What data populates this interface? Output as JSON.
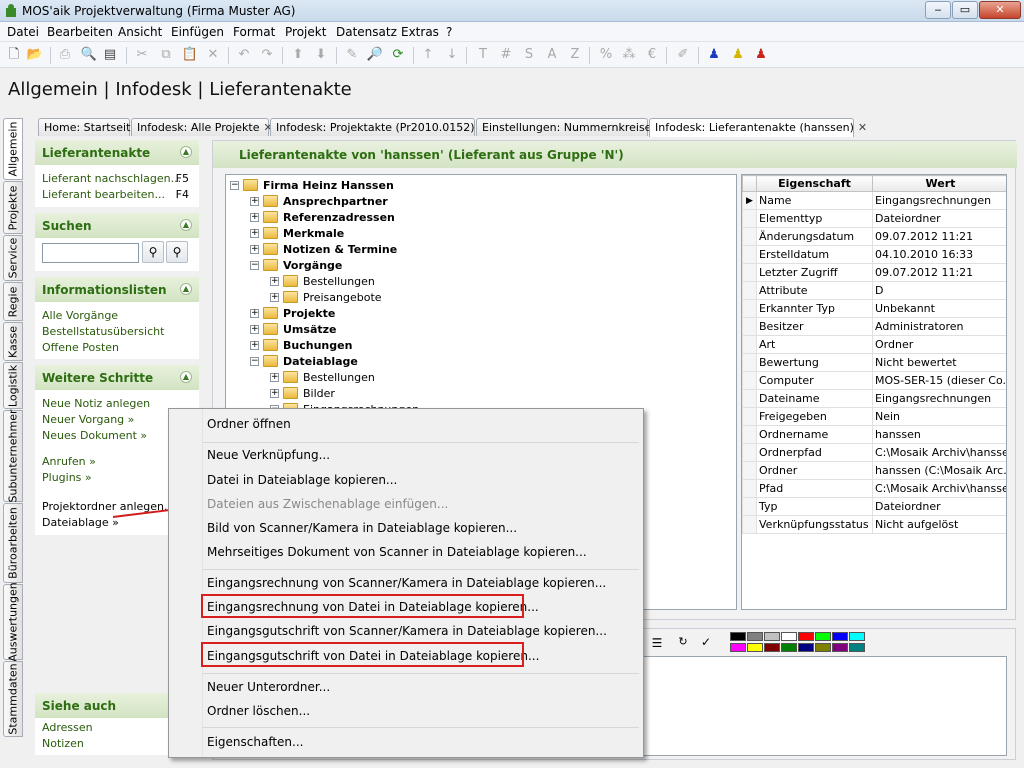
{
  "window": {
    "title": "MOS'aik Projektverwaltung (Firma Muster AG)",
    "minimize": "‒",
    "maximize": "▭",
    "close": "✕"
  },
  "menu": [
    "Datei",
    "Bearbeiten",
    "Ansicht",
    "Einfügen",
    "Format",
    "Projekt",
    "Datensatz",
    "Extras",
    "?"
  ],
  "breadcrumb": "Allgemein | Infodesk | Lieferantenakte",
  "tabs": [
    {
      "label": "Home: Startseite",
      "closable": false
    },
    {
      "label": "Infodesk: Alle Projekte",
      "closable": true
    },
    {
      "label": "Infodesk: Projektakte (Pr2010.0152)",
      "closable": true
    },
    {
      "label": "Einstellungen: Nummernkreise",
      "closable": true
    },
    {
      "label": "Infodesk: Lieferantenakte (hanssen)",
      "closable": true,
      "active": true
    }
  ],
  "vertical_tabs": [
    "Allgemein",
    "Projekte",
    "Service",
    "Regie",
    "Kasse",
    "Logistik",
    "Subunternehmer",
    "Büroarbeiten",
    "Auswertungen",
    "Stammdaten"
  ],
  "sidebar": {
    "lieferantenakte": {
      "title": "Lieferantenakte",
      "items": [
        {
          "label": "Lieferant nachschlagen...",
          "shortcut": "F5"
        },
        {
          "label": "Lieferant bearbeiten...",
          "shortcut": "F4"
        }
      ]
    },
    "suchen": {
      "title": "Suchen",
      "value": ""
    },
    "informationslisten": {
      "title": "Informationslisten",
      "items": [
        "Alle Vorgänge",
        "Bestellstatusübersicht",
        "Offene Posten"
      ]
    },
    "weitere_schritte": {
      "title": "Weitere Schritte",
      "items": [
        "Neue Notiz anlegen",
        "Neuer Vorgang »",
        "Neues Dokument »",
        "Anrufen »",
        "Plugins »",
        "Projektordner anlegen...",
        "Dateiablage »"
      ]
    },
    "siehe_auch": {
      "title": "Siehe auch",
      "items": [
        "Adressen",
        "Notizen"
      ]
    }
  },
  "main": {
    "header": "Lieferantenakte von 'hanssen' (Lieferant aus Gruppe 'N')",
    "tree": [
      {
        "label": "Firma Heinz Hanssen",
        "bold": true,
        "pm": "−"
      },
      {
        "label": "Ansprechpartner",
        "bold": true,
        "pm": "+"
      },
      {
        "label": "Referenzadressen",
        "bold": true,
        "pm": "+"
      },
      {
        "label": "Merkmale",
        "bold": true,
        "pm": "+"
      },
      {
        "label": "Notizen & Termine",
        "bold": true,
        "pm": "+"
      },
      {
        "label": "Vorgänge",
        "bold": true,
        "pm": "−"
      },
      {
        "label": "Bestellungen",
        "bold": false,
        "pm": "+"
      },
      {
        "label": "Preisangebote",
        "bold": false,
        "pm": "+"
      },
      {
        "label": "Projekte",
        "bold": true,
        "pm": "+"
      },
      {
        "label": "Umsätze",
        "bold": true,
        "pm": "+"
      },
      {
        "label": "Buchungen",
        "bold": true,
        "pm": "+"
      },
      {
        "label": "Dateiablage",
        "bold": true,
        "pm": "−"
      },
      {
        "label": "Bestellungen",
        "bold": false,
        "pm": "+"
      },
      {
        "label": "Bilder",
        "bold": false,
        "pm": "+"
      },
      {
        "label": "Eingangsrechnungen",
        "bold": false,
        "pm": "−"
      }
    ],
    "grid": {
      "headers": [
        "Eigenschaft",
        "Wert"
      ],
      "rows": [
        [
          "Name",
          "Eingangsrechnungen"
        ],
        [
          "Elementtyp",
          "Dateiordner"
        ],
        [
          "Änderungsdatum",
          "09.07.2012 11:21"
        ],
        [
          "Erstelldatum",
          "04.10.2010 16:33"
        ],
        [
          "Letzter Zugriff",
          "09.07.2012 11:21"
        ],
        [
          "Attribute",
          "D"
        ],
        [
          "Erkannter Typ",
          "Unbekannt"
        ],
        [
          "Besitzer",
          "Administratoren"
        ],
        [
          "Art",
          "Ordner"
        ],
        [
          "Bewertung",
          "Nicht bewertet"
        ],
        [
          "Computer",
          "MOS-SER-15 (dieser Co..."
        ],
        [
          "Dateiname",
          "Eingangsrechnungen"
        ],
        [
          "Freigegeben",
          "Nein"
        ],
        [
          "Ordnername",
          "hanssen"
        ],
        [
          "Ordnerpfad",
          "C:\\Mosaik Archiv\\hanssen"
        ],
        [
          "Ordner",
          "hanssen (C:\\Mosaik Arc..."
        ],
        [
          "Pfad",
          "C:\\Mosaik Archiv\\hansse..."
        ],
        [
          "Typ",
          "Dateiordner"
        ],
        [
          "Verknüpfungsstatus",
          "Nicht aufgelöst"
        ]
      ]
    }
  },
  "context_menu": [
    {
      "label": "Ordner öffnen"
    },
    {
      "sep": true
    },
    {
      "label": "Neue Verknüpfung..."
    },
    {
      "label": "Datei in Dateiablage kopieren..."
    },
    {
      "label": "Dateien aus Zwischenablage einfügen...",
      "disabled": true
    },
    {
      "label": "Bild von Scanner/Kamera in Dateiablage kopieren..."
    },
    {
      "label": "Mehrseitiges Dokument von Scanner in Dateiablage kopieren..."
    },
    {
      "sep": true
    },
    {
      "label": "Eingangsrechnung von Scanner/Kamera in Dateiablage kopieren..."
    },
    {
      "label": "Eingangsrechnung von Datei in Dateiablage kopieren...",
      "highlight": true
    },
    {
      "label": "Eingangsgutschrift von Scanner/Kamera in Dateiablage kopieren..."
    },
    {
      "label": "Eingangsgutschrift von Datei in Dateiablage kopieren...",
      "highlight": true
    },
    {
      "sep": true
    },
    {
      "label": "Neuer Unterordner..."
    },
    {
      "label": "Ordner löschen..."
    },
    {
      "sep": true
    },
    {
      "label": "Eigenschaften..."
    }
  ],
  "colors": {
    "accent_green": "#2e6e12",
    "highlight_red": "#d91e1e"
  },
  "palette": [
    "#000000",
    "#808080",
    "#c0c0c0",
    "#ffffff",
    "#ff0000",
    "#00ff00",
    "#0000ff",
    "#00ffff",
    "#ff00ff",
    "#ffff00",
    "#800000",
    "#008000",
    "#000080",
    "#808000",
    "#800080",
    "#008080"
  ]
}
